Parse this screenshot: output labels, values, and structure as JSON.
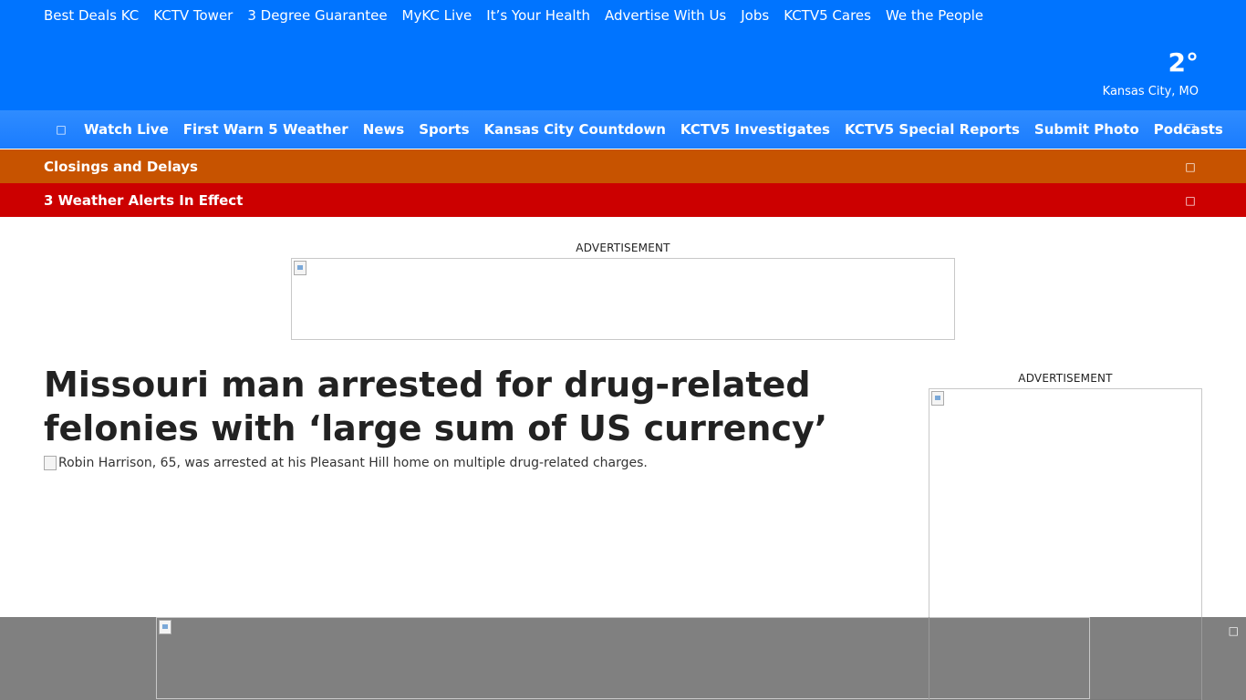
{
  "utility_nav": [
    "Best Deals KC",
    "KCTV Tower",
    "3 Degree Guarantee",
    "MyKC Live",
    "It’s Your Health",
    "Advertise With Us",
    "Jobs",
    "KCTV5 Cares",
    "We the People"
  ],
  "weather": {
    "temp": "2°",
    "location": "Kansas City, MO"
  },
  "main_nav": {
    "menu_icon": "menu-icon",
    "items": [
      "Watch Live",
      "First Warn 5 Weather",
      "News",
      "Sports",
      "Kansas City Countdown",
      "KCTV5 Investigates",
      "KCTV5 Special Reports",
      "Submit Photo",
      "Podcasts"
    ],
    "search_icon": "search-icon"
  },
  "closings_bar": {
    "label": "Closings and Delays",
    "icon": "chevron-icon"
  },
  "alerts_bar": {
    "label": "3 Weather Alerts In Effect",
    "icon": "chevron-icon"
  },
  "ads": {
    "top_label": "ADVERTISEMENT",
    "side_label": "ADVERTISEMENT"
  },
  "article": {
    "headline": "Missouri man arrested for drug-related felonies with ‘large sum of US currency’",
    "image_alt": "Robin Harrison, 65, was arrested at his Pleasant Hill home on multiple drug-related charges."
  },
  "bottom_ad": {
    "close_icon": "close-icon"
  },
  "colors": {
    "header_blue": "#0074ff",
    "closings_orange": "#c75300",
    "alerts_red": "#cc0000"
  }
}
